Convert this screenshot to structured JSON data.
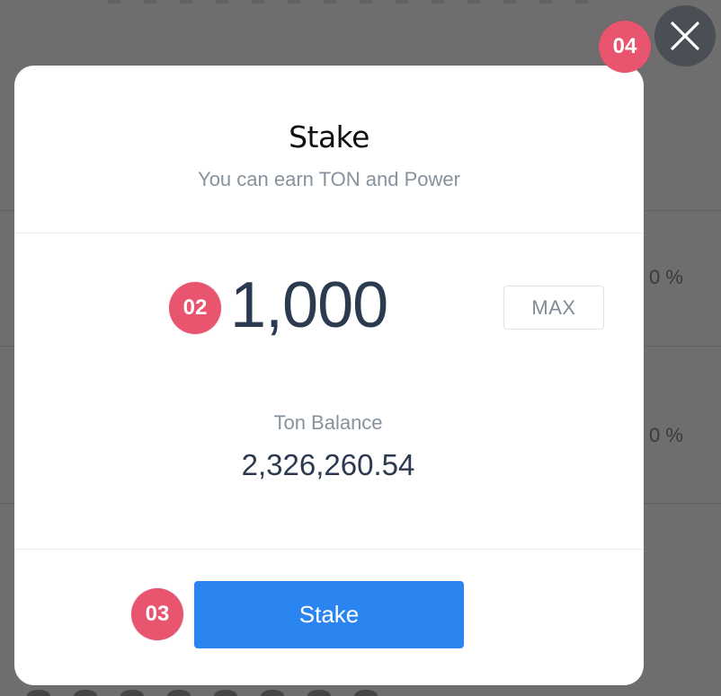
{
  "background": {
    "row_values": [
      "0 %",
      "0 %"
    ]
  },
  "modal": {
    "title": "Stake",
    "subtitle": "You can earn TON and Power",
    "amount": "1,000",
    "max_label": "MAX",
    "balance_label": "Ton Balance",
    "balance_value": "2,326,260.54",
    "stake_label": "Stake"
  },
  "markers": {
    "amount": "02",
    "stake": "03",
    "close": "04"
  },
  "icons": {
    "close": "close-icon"
  },
  "colors": {
    "accent": "#2a85f0",
    "marker": "#e9546f",
    "overlay": "#6e6e6e"
  }
}
